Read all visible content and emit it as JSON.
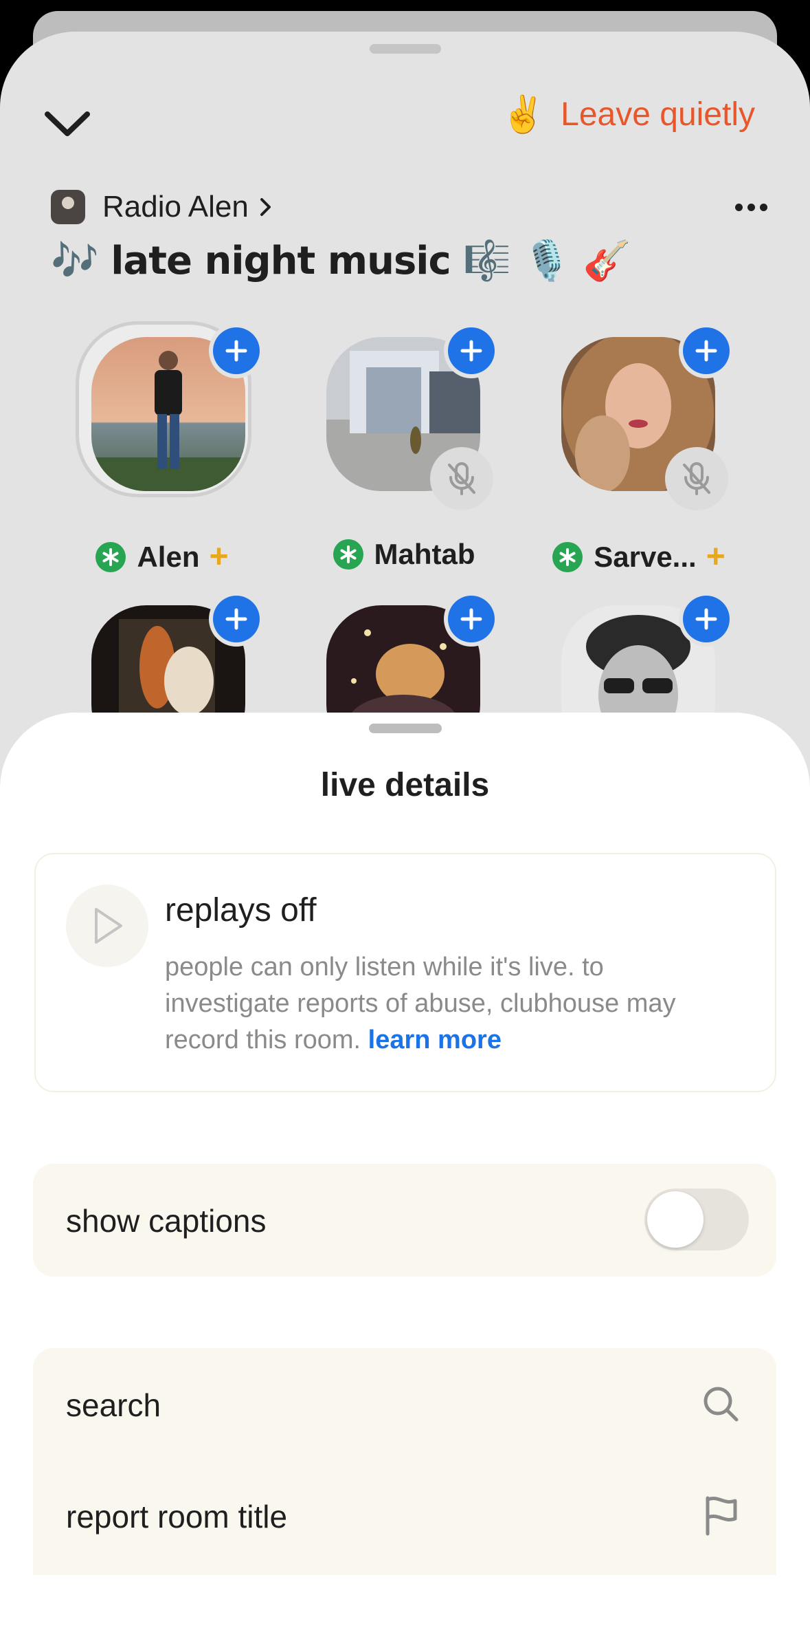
{
  "room": {
    "leave_emoji": "✌️",
    "leave_label": "Leave quietly",
    "club_name": "Radio Alen",
    "title": "🎶 late night music 🎼 🎙️ 🎸",
    "speakers": [
      {
        "name": "Alen",
        "moderator": true,
        "muted": false,
        "speaking": true,
        "new_user": true
      },
      {
        "name": "Mahtab",
        "moderator": true,
        "muted": true,
        "speaking": false,
        "new_user": false
      },
      {
        "name": "Sarve...",
        "moderator": true,
        "muted": true,
        "speaking": false,
        "new_user": true
      },
      {
        "name": "",
        "moderator": false,
        "muted": false,
        "speaking": false,
        "new_user": false
      },
      {
        "name": "",
        "moderator": false,
        "muted": false,
        "speaking": false,
        "new_user": false
      },
      {
        "name": "",
        "moderator": false,
        "muted": false,
        "speaking": false,
        "new_user": false
      }
    ],
    "plus_mark": "+"
  },
  "sheet": {
    "title": "live details",
    "replay": {
      "title": "replays off",
      "description": "people can only listen while it's live. to investigate reports of abuse, clubhouse may record this room.",
      "link": "learn more"
    },
    "captions": {
      "label": "show captions",
      "enabled": false
    },
    "actions": [
      {
        "label": "search",
        "icon": "search-icon"
      },
      {
        "label": "report room title",
        "icon": "flag-icon"
      }
    ]
  },
  "colors": {
    "accent_orange": "#e8562a",
    "follow_blue": "#1f73e6",
    "moderator_green": "#27a552",
    "link_blue": "#1a73e8",
    "new_user_gold": "#e5a820"
  }
}
